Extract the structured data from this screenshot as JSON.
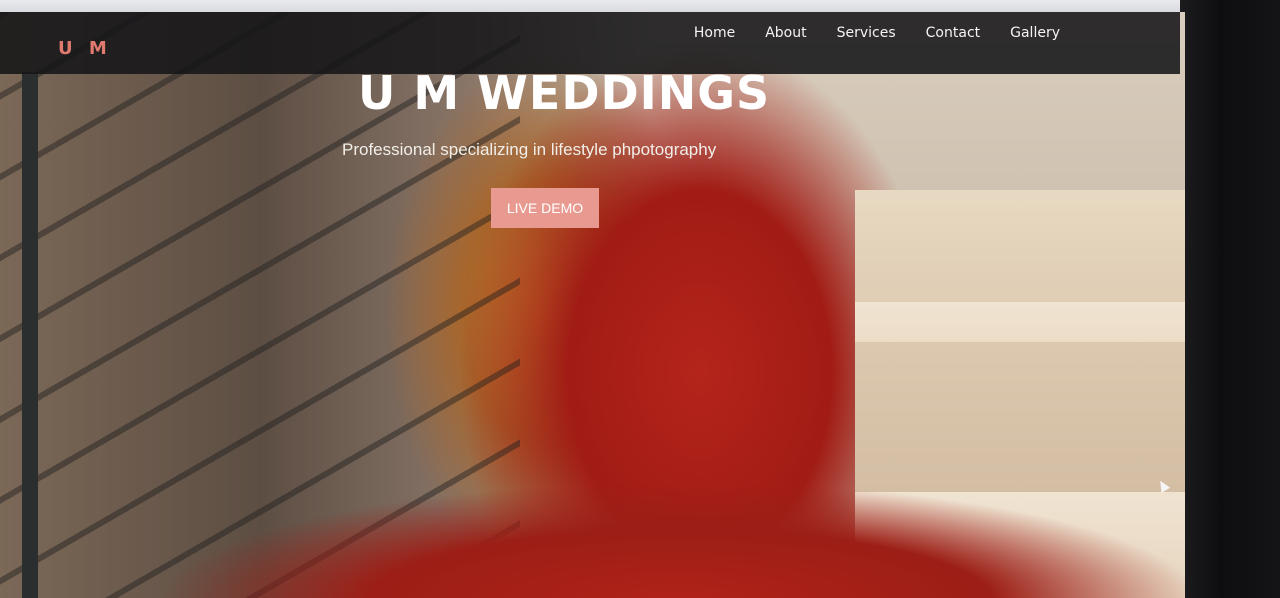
{
  "navbar": {
    "brand": "U M",
    "links": [
      {
        "label": "Home"
      },
      {
        "label": "About"
      },
      {
        "label": "Services"
      },
      {
        "label": "Contact"
      },
      {
        "label": "Gallery"
      }
    ]
  },
  "hero": {
    "title": "U M WEDDINGS",
    "subtitle": "Professional specializing in lifestyle phpotography",
    "button_label": "LIVE DEMO"
  },
  "colors": {
    "brand_accent": "#e07a6e",
    "button_bg": "#e99a90",
    "navbar_bg": "#161618"
  }
}
